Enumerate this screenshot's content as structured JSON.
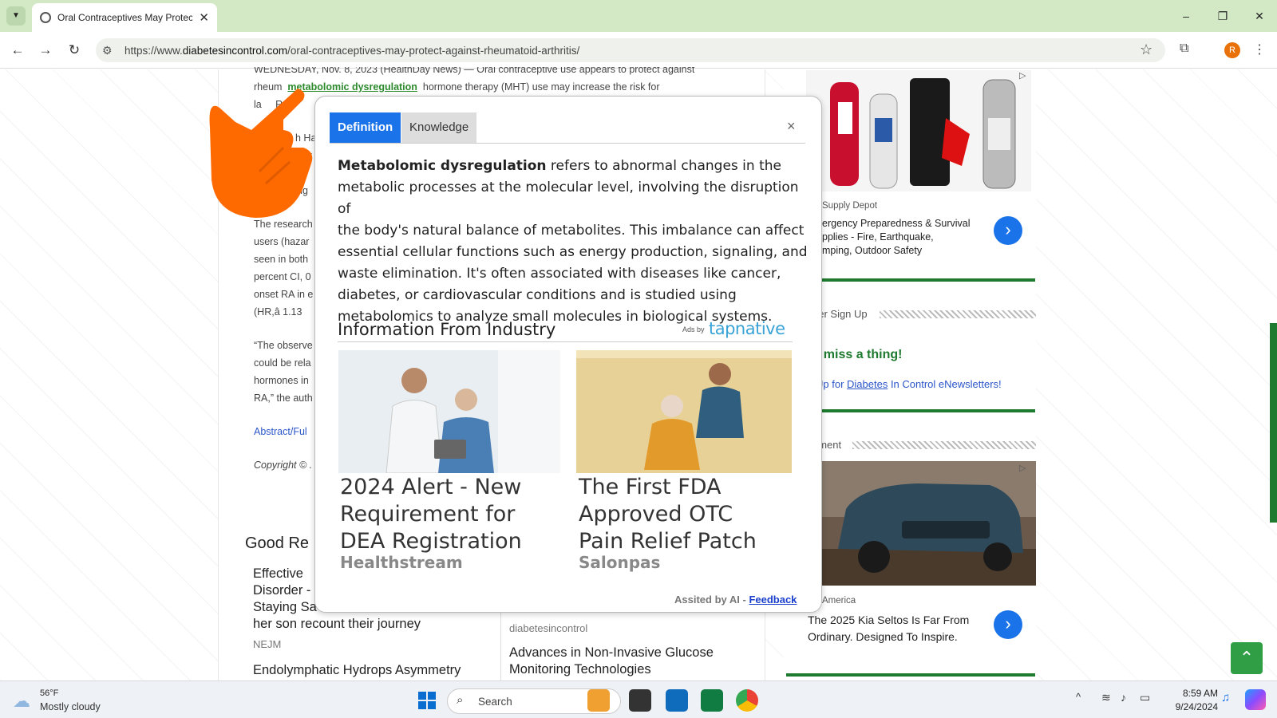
{
  "browser": {
    "tab_title": "Oral Contraceptives May Protec",
    "url_prefix": "https://www.",
    "url_domain": "diabetesincontrol.com",
    "url_path": "/oral-contraceptives-may-protect-against-rheumatoid-arthritis/",
    "profile_initial": "R"
  },
  "article": {
    "line1": "WEDNESDAY, Nov. 8, 2023 (HealthDay News) — Oral contraceptive use appears to protect against",
    "line2_pre": "rheum",
    "line2_hl": "metabolomic dysregulation",
    "line2_post": "hormone therapy (MHT) use may increase the risk for",
    "line3": "la",
    "line3b": "RA",
    "frag1": "h Ha",
    "frag2": "ex",
    "frag3": "ng",
    "res1": "The research",
    "res2": "users (hazar",
    "res3": "seen in both",
    "res4": "percent CI, 0",
    "res5": "onset RA in e",
    "res6": "(HR,â     1.13",
    "obs1": "“The observe",
    "obs2": "could be rela",
    "obs3": "hormones in",
    "obs4": "RA,” the auth",
    "abstract": "Abstract/Ful",
    "copyright": "Copyright © ."
  },
  "good_reads": {
    "title": "Good Re",
    "left_item1_l1": "Effective",
    "left_item1_l2": "Disorder -",
    "left_item1_l3": "Staying Sa",
    "left_item1_l4": "her son recount their journey",
    "left_item1_src": "NEJM",
    "left_item2": "Endolymphatic Hydrops Asymmetry",
    "right_src": "diabetesincontrol",
    "right_item_l1": "Advances in Non-Invasive Glucose",
    "right_item_l2": "Monitoring Technologies"
  },
  "sidebar": {
    "ad1_source": "Supply Depot",
    "ad1_l1": "ergency Preparedness & Survival",
    "ad1_l2": "pplies - Fire, Earthquake,",
    "ad1_l3": "mping, Outdoor Safety",
    "newsletter_head": "tter Sign Up",
    "newsletter_title": "t miss a thing!",
    "newsletter_pre": "Up for ",
    "newsletter_link": "Diabetes",
    "newsletter_post": " In Control eNewsletters!",
    "ad_head": "ement",
    "ad2_source": "America",
    "ad2_l1": "The 2025 Kia Seltos Is Far From",
    "ad2_l2": "Ordinary. Designed To Inspire."
  },
  "popup": {
    "tab_definition": "Definition",
    "tab_knowledge": "Knowledge",
    "close": "×",
    "term": "Metabolomic dysregulation",
    "definition_l1": " refers to abnormal changes in the",
    "definition_l2": "metabolic processes at the molecular level, involving the disruption of",
    "definition_l3": "the body's natural balance of metabolites. This imbalance can affect",
    "definition_l4": "essential cellular functions such as energy production, signaling, and",
    "definition_l5": "waste elimination. It's often associated with diseases like cancer,",
    "definition_l6": "diabetes, or cardiovascular conditions and is studied using",
    "definition_l7": "metabolomics to analyze small molecules in biological systems.",
    "industry_heading": "Information From Industry",
    "ads_by": "Ads by",
    "tapnative": "tapnative",
    "card1_l1": "2024 Alert - New",
    "card1_l2": "Requirement for",
    "card1_l3": "DEA Registration",
    "card1_source": "Healthstream",
    "card2_l1": "The First FDA",
    "card2_l2": "Approved OTC",
    "card2_l3": "Pain Relief Patch",
    "card2_source": "Salonpas",
    "assisted": "Assited by AI - ",
    "feedback": "Feedback"
  },
  "taskbar": {
    "temp": "56°F",
    "weather": "Mostly cloudy",
    "search_placeholder": "Search",
    "time": "8:59 AM",
    "date": "9/24/2024"
  },
  "colors": {
    "accent_blue": "#1a73e8",
    "site_green": "#1e7a2e",
    "tabbar_green": "#d3e9c6",
    "hand_orange": "#ff6a00"
  }
}
